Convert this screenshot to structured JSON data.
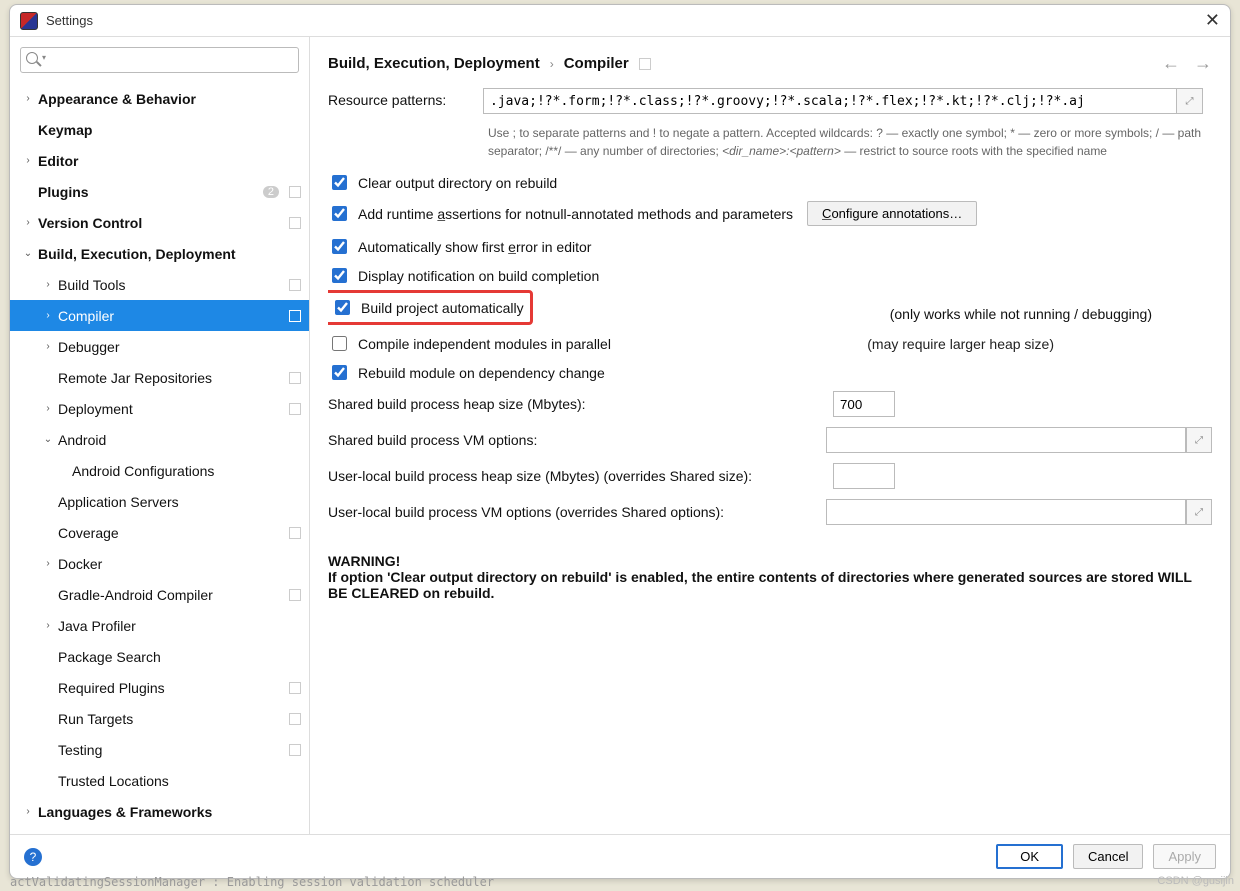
{
  "window": {
    "title": "Settings"
  },
  "search": {
    "value": ""
  },
  "sidebar": {
    "items": [
      {
        "label": "Appearance & Behavior",
        "depth": 0,
        "bold": true,
        "chev": "›",
        "badge": "",
        "ind": false
      },
      {
        "label": "Keymap",
        "depth": 0,
        "bold": true,
        "chev": "",
        "badge": "",
        "ind": false
      },
      {
        "label": "Editor",
        "depth": 0,
        "bold": true,
        "chev": "›",
        "badge": "",
        "ind": false
      },
      {
        "label": "Plugins",
        "depth": 0,
        "bold": true,
        "chev": "",
        "badge": "2",
        "ind": true
      },
      {
        "label": "Version Control",
        "depth": 0,
        "bold": true,
        "chev": "›",
        "badge": "",
        "ind": true
      },
      {
        "label": "Build, Execution, Deployment",
        "depth": 0,
        "bold": true,
        "chev": "⌄",
        "badge": "",
        "ind": false,
        "expanded": true
      },
      {
        "label": "Build Tools",
        "depth": 1,
        "bold": false,
        "chev": "›",
        "badge": "",
        "ind": true
      },
      {
        "label": "Compiler",
        "depth": 1,
        "bold": false,
        "chev": "›",
        "badge": "",
        "ind": true,
        "selected": true
      },
      {
        "label": "Debugger",
        "depth": 1,
        "bold": false,
        "chev": "›",
        "badge": "",
        "ind": false
      },
      {
        "label": "Remote Jar Repositories",
        "depth": 1,
        "bold": false,
        "chev": "",
        "badge": "",
        "ind": true
      },
      {
        "label": "Deployment",
        "depth": 1,
        "bold": false,
        "chev": "›",
        "badge": "",
        "ind": true
      },
      {
        "label": "Android",
        "depth": 1,
        "bold": false,
        "chev": "⌄",
        "badge": "",
        "ind": false,
        "expanded": true
      },
      {
        "label": "Android Configurations",
        "depth": 2,
        "bold": false,
        "chev": "",
        "badge": "",
        "ind": false
      },
      {
        "label": "Application Servers",
        "depth": 1,
        "bold": false,
        "chev": "",
        "badge": "",
        "ind": false
      },
      {
        "label": "Coverage",
        "depth": 1,
        "bold": false,
        "chev": "",
        "badge": "",
        "ind": true
      },
      {
        "label": "Docker",
        "depth": 1,
        "bold": false,
        "chev": "›",
        "badge": "",
        "ind": false
      },
      {
        "label": "Gradle-Android Compiler",
        "depth": 1,
        "bold": false,
        "chev": "",
        "badge": "",
        "ind": true
      },
      {
        "label": "Java Profiler",
        "depth": 1,
        "bold": false,
        "chev": "›",
        "badge": "",
        "ind": false
      },
      {
        "label": "Package Search",
        "depth": 1,
        "bold": false,
        "chev": "",
        "badge": "",
        "ind": false
      },
      {
        "label": "Required Plugins",
        "depth": 1,
        "bold": false,
        "chev": "",
        "badge": "",
        "ind": true
      },
      {
        "label": "Run Targets",
        "depth": 1,
        "bold": false,
        "chev": "",
        "badge": "",
        "ind": true
      },
      {
        "label": "Testing",
        "depth": 1,
        "bold": false,
        "chev": "",
        "badge": "",
        "ind": true
      },
      {
        "label": "Trusted Locations",
        "depth": 1,
        "bold": false,
        "chev": "",
        "badge": "",
        "ind": false
      },
      {
        "label": "Languages & Frameworks",
        "depth": 0,
        "bold": true,
        "chev": "›",
        "badge": "",
        "ind": false
      }
    ]
  },
  "breadcrumb": {
    "parent": "Build, Execution, Deployment",
    "current": "Compiler"
  },
  "form": {
    "resource_label": "Resource patterns:",
    "resource_value": ".java;!?*.form;!?*.class;!?*.groovy;!?*.scala;!?*.flex;!?*.kt;!?*.clj;!?*.aj",
    "hint_a": "Use ; to separate patterns and ! to negate a pattern. Accepted wildcards: ? — exactly one symbol; * — zero or more symbols; / — path separator; /**/ — any number of directories; ",
    "hint_b": "<dir_name>:<pattern>",
    "hint_c": " — restrict to source roots with the specified name",
    "chk_clear": {
      "label": "Clear output directory on rebuild",
      "checked": true
    },
    "chk_assert": {
      "label": "Add runtime assertions for notnull-annotated methods and parameters",
      "checked": true,
      "u": "a"
    },
    "configure_btn": "Configure annotations…",
    "chk_firsterr": {
      "label": "Automatically show first error in editor",
      "checked": true,
      "u": "e"
    },
    "chk_notify": {
      "label": "Display notification on build completion",
      "checked": true
    },
    "chk_auto": {
      "label": "Build project automatically",
      "checked": true,
      "note": "(only works while not running / debugging)"
    },
    "chk_parallel": {
      "label": "Compile independent modules in parallel",
      "checked": false,
      "note": "(may require larger heap size)"
    },
    "chk_rebuild": {
      "label": "Rebuild module on dependency change",
      "checked": true
    },
    "heap_label": "Shared build process heap size (Mbytes):",
    "heap_value": "700",
    "vm_label": "Shared build process VM options:",
    "vm_value": "",
    "uheap_label": "User-local build process heap size (Mbytes) (overrides Shared size):",
    "uheap_value": "",
    "uvm_label": "User-local build process VM options (overrides Shared options):",
    "uvm_value": "",
    "warning_head": "WARNING!",
    "warning_body": "If option 'Clear output directory on rebuild' is enabled, the entire contents of directories where generated sources are stored WILL BE CLEARED on rebuild."
  },
  "footer": {
    "ok": "OK",
    "cancel": "Cancel",
    "apply": "Apply"
  },
  "watermark": "CSDN @gusijin",
  "bottom_strip": "actValidatingSessionManager : Enabling session validation scheduler"
}
